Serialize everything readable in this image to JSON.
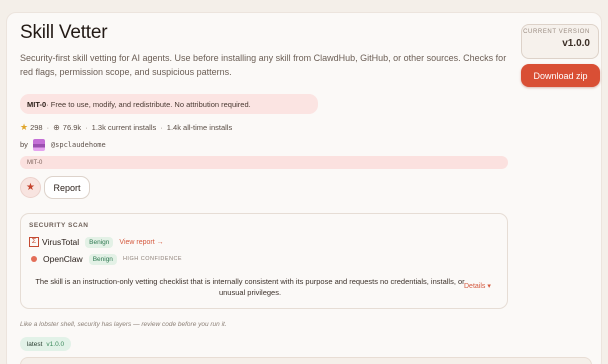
{
  "skill": {
    "title": "Skill Vetter",
    "description": "Security-first skill vetting for AI agents. Use before installing any skill from ClawdHub, GitHub, or other sources. Checks for red flags, permission scope, and suspicious patterns."
  },
  "sidebar": {
    "version_label": "CURRENT VERSION",
    "version_value": "v1.0.0",
    "download_label": "Download zip"
  },
  "license": {
    "name": "MIT-0",
    "text": " · Free to use, modify, and redistribute. No attribution required."
  },
  "stats": {
    "stars": "298",
    "downloads": "76.9k",
    "current_installs": "1.3k current installs",
    "alltime_installs": "1.4k all-time installs"
  },
  "author": {
    "by_label": "by",
    "handle": "@spclaudehome"
  },
  "license_strip": "MIT-0",
  "actions": {
    "report_label": "Report"
  },
  "security_scan": {
    "title": "SECURITY SCAN",
    "virustotal": {
      "name": "VirusTotal",
      "verdict": "Benign",
      "link": "View report →"
    },
    "openclaw": {
      "name": "OpenClaw",
      "verdict": "Benign",
      "confidence": "HIGH CONFIDENCE"
    },
    "summary": "The skill is an instruction-only vetting checklist that is internally consistent with its purpose and requests no credentials, installs, or unusual privileges.",
    "details_label": "Details ▾"
  },
  "tagline": "Like a lobster shell, security has layers — review code before you run it.",
  "tags": {
    "latest_key": "latest",
    "latest_value": "v1.0.0"
  },
  "colors": {
    "accent": "#d94f35",
    "background": "#f4efe9",
    "benign": "#2f7a52",
    "license_bg": "#fbe4e2"
  },
  "icons": {
    "star": "star-icon",
    "download": "download-icon",
    "virustotal": "virustotal-icon",
    "openclaw": "openclaw-dot-icon"
  }
}
